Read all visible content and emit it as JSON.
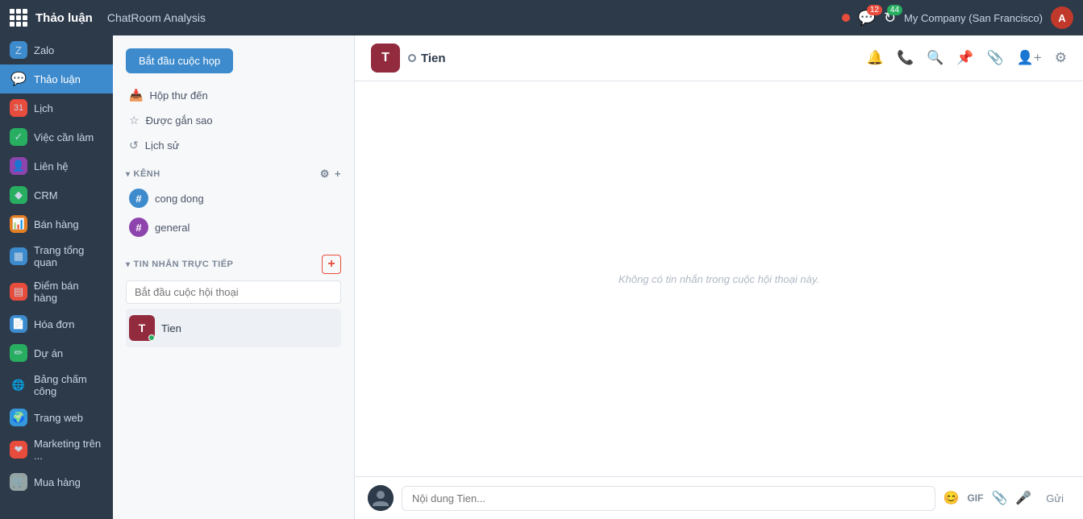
{
  "topbar": {
    "app_name": "Thảo luận",
    "page_title": "ChatRoom Analysis",
    "notifications_count": "12",
    "refresh_count": "44",
    "company": "My Company (San Francisco)",
    "avatar_initials": "A"
  },
  "sidebar": {
    "items": [
      {
        "id": "zalo",
        "label": "Zalo",
        "icon": "Z",
        "icon_bg": "#3d8bcd",
        "active": false
      },
      {
        "id": "thao-luan",
        "label": "Thảo luận",
        "icon": "💬",
        "icon_bg": "transparent",
        "active": true
      },
      {
        "id": "lich",
        "label": "Lịch",
        "icon": "31",
        "icon_bg": "#e74c3c",
        "active": false
      },
      {
        "id": "viec-can-lam",
        "label": "Việc cần làm",
        "icon": "✓",
        "icon_bg": "#27ae60",
        "active": false
      },
      {
        "id": "lien-he",
        "label": "Liên hệ",
        "icon": "👤",
        "icon_bg": "#8e44ad",
        "active": false
      },
      {
        "id": "crm",
        "label": "CRM",
        "icon": "◆",
        "icon_bg": "#27ae60",
        "active": false
      },
      {
        "id": "ban-hang",
        "label": "Bán hàng",
        "icon": "📊",
        "icon_bg": "#e67e22",
        "active": false
      },
      {
        "id": "trang-tong-quan",
        "label": "Trang tổng quan",
        "icon": "▦",
        "icon_bg": "#3d8bcd",
        "active": false
      },
      {
        "id": "diem-ban-hang",
        "label": "Điểm bán hàng",
        "icon": "▤",
        "icon_bg": "#e74c3c",
        "active": false
      },
      {
        "id": "hoa-don",
        "label": "Hóa đơn",
        "icon": "📄",
        "icon_bg": "#3d8bcd",
        "active": false
      },
      {
        "id": "du-an",
        "label": "Dự án",
        "icon": "✏",
        "icon_bg": "#27ae60",
        "active": false
      },
      {
        "id": "bang-cham-cong",
        "label": "Bảng chấm công",
        "icon": "🌐",
        "icon_bg": "#2d3a4a",
        "active": false
      },
      {
        "id": "trang-web",
        "label": "Trang web",
        "icon": "🌍",
        "icon_bg": "#3498db",
        "active": false
      },
      {
        "id": "marketing",
        "label": "Marketing trên ...",
        "icon": "❤",
        "icon_bg": "#e74c3c",
        "active": false
      },
      {
        "id": "mua-hang",
        "label": "Mua hàng",
        "icon": "🛒",
        "icon_bg": "#95a5a6",
        "active": false
      }
    ]
  },
  "chat_list": {
    "btn_start_meeting": "Bắt đầu cuộc họp",
    "menu_items": [
      {
        "id": "inbox",
        "label": "Hộp thư đến",
        "icon": "📥"
      },
      {
        "id": "starred",
        "label": "Được gắn sao",
        "icon": "☆"
      },
      {
        "id": "history",
        "label": "Lịch sử",
        "icon": "↺"
      }
    ],
    "kenh_section": "KÊNH",
    "channels": [
      {
        "id": "cong-dong",
        "label": "cong dong",
        "icon": "#"
      },
      {
        "id": "general",
        "label": "general",
        "icon": "#"
      }
    ],
    "dm_section": "TIN NHẮN TRỰC TIẾP",
    "dm_search_placeholder": "Bắt đầu cuộc hội thoại",
    "dm_items": [
      {
        "id": "tien",
        "name": "Tien",
        "initials": "T",
        "status": "online"
      }
    ]
  },
  "chat_area": {
    "current_user": {
      "name": "Tien",
      "initials": "T",
      "avatar_bg": "#922b3e",
      "status": "away"
    },
    "no_messages_text": "Không có tin nhắn trong cuộc hội thoại này.",
    "input_placeholder": "Nội dung Tien...",
    "send_label": "Gửi",
    "header_icons": [
      {
        "id": "bell",
        "symbol": "🔔"
      },
      {
        "id": "phone",
        "symbol": "📞"
      },
      {
        "id": "search",
        "symbol": "🔍"
      },
      {
        "id": "pin",
        "symbol": "📌"
      },
      {
        "id": "paperclip",
        "symbol": "📎"
      },
      {
        "id": "add-user",
        "symbol": "👤+"
      },
      {
        "id": "settings",
        "symbol": "⚙"
      }
    ]
  }
}
